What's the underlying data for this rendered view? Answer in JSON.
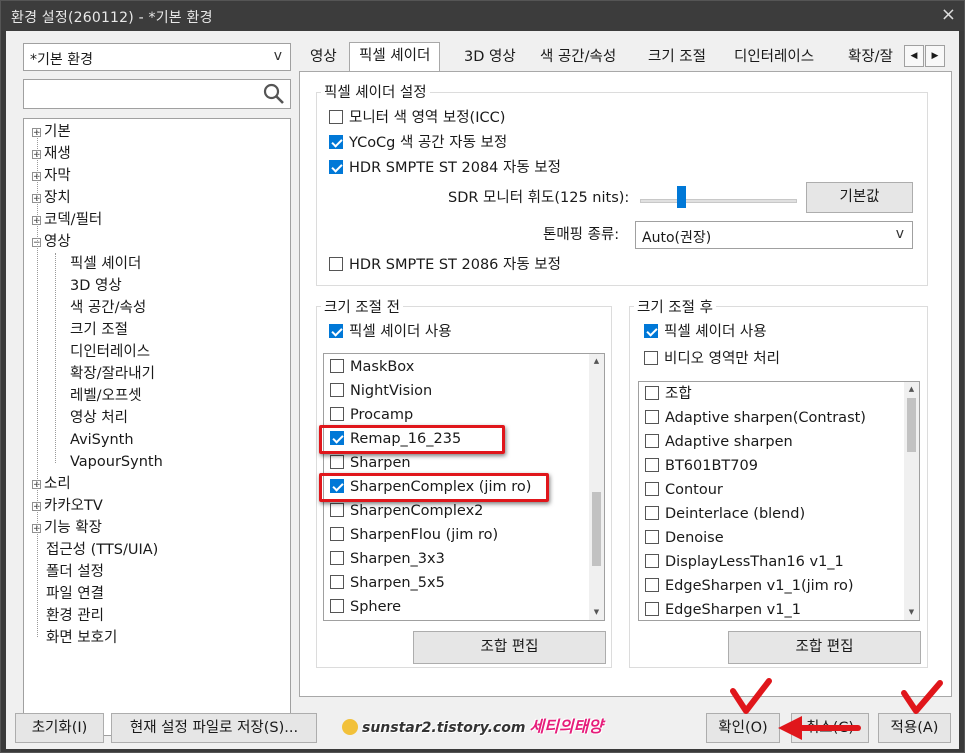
{
  "window": {
    "title": "환경 설정(260112) - *기본 환경",
    "close": "×"
  },
  "profile_combo": {
    "value": "*기본 환경",
    "arrow": "v"
  },
  "search": {
    "placeholder": ""
  },
  "tree": {
    "items": [
      {
        "label": "기본",
        "exp": "+"
      },
      {
        "label": "재생",
        "exp": "+"
      },
      {
        "label": "자막",
        "exp": "+"
      },
      {
        "label": "장치",
        "exp": "+"
      },
      {
        "label": "코덱/필터",
        "exp": "+"
      },
      {
        "label": "영상",
        "exp": "−"
      },
      {
        "label": "픽셀 셰이더"
      },
      {
        "label": "3D 영상"
      },
      {
        "label": "색 공간/속성"
      },
      {
        "label": "크기 조절"
      },
      {
        "label": "디인터레이스"
      },
      {
        "label": "확장/잘라내기"
      },
      {
        "label": "레벨/오프셋"
      },
      {
        "label": "영상 처리"
      },
      {
        "label": "AviSynth"
      },
      {
        "label": "VapourSynth"
      },
      {
        "label": "소리",
        "exp": "+"
      },
      {
        "label": "카카오TV",
        "exp": "+"
      },
      {
        "label": "기능 확장",
        "exp": "+"
      },
      {
        "label": "접근성 (TTS/UIA)"
      },
      {
        "label": "폴더 설정"
      },
      {
        "label": "파일 연결"
      },
      {
        "label": "환경 관리"
      },
      {
        "label": "화면 보호기"
      }
    ]
  },
  "tabs": [
    "영상",
    "픽셀 셰이더",
    "3D 영상",
    "색 공간/속성",
    "크기 조절",
    "디인터레이스",
    "확장/잘"
  ],
  "tab_nav": {
    "left": "◀",
    "right": "▶"
  },
  "shader_settings": {
    "title": "픽셀 셰이더 설정",
    "monitor_icc": "모니터 색 영역 보정(ICC)",
    "ycocg": "YCoCg 색 공간 자동 보정",
    "hdr2084": "HDR SMPTE ST 2084 자동 보정",
    "sdr_label": "SDR 모니터 휘도(125 nits):",
    "sdr_level_nits": 125,
    "default_button": "기본값",
    "tonemap_label": "톤매핑 종류:",
    "tonemap_value": "Auto(권장)",
    "hdr2086": "HDR SMPTE ST 2086 자동 보정"
  },
  "pre": {
    "title": "크기 조절 전",
    "use": "픽셀 셰이더 사용",
    "items": [
      {
        "label": "MaskBox",
        "checked": false
      },
      {
        "label": "NightVision",
        "checked": false
      },
      {
        "label": "Procamp",
        "checked": false
      },
      {
        "label": "Remap_16_235",
        "checked": true
      },
      {
        "label": "Sharpen",
        "checked": false
      },
      {
        "label": "SharpenComplex (jim ro)",
        "checked": true
      },
      {
        "label": "SharpenComplex2",
        "checked": false
      },
      {
        "label": "SharpenFlou (jim ro)",
        "checked": false
      },
      {
        "label": "Sharpen_3x3",
        "checked": false
      },
      {
        "label": "Sharpen_5x5",
        "checked": false
      },
      {
        "label": "Sphere",
        "checked": false
      }
    ],
    "edit": "조합 편집"
  },
  "post": {
    "title": "크기 조절 후",
    "use": "픽셀 셰이더 사용",
    "video_only": "비디오 영역만 처리",
    "items": [
      "조합",
      "Adaptive sharpen(Contrast)",
      "Adaptive sharpen",
      "BT601BT709",
      "Contour",
      "Deinterlace (blend)",
      "Denoise",
      "DisplayLessThan16 v1_1",
      "EdgeSharpen v1_1(jim ro)",
      "EdgeSharpen v1_1"
    ],
    "edit": "조합 편집"
  },
  "bottom": {
    "reset": "초기화(I)",
    "save": "현재 설정 파일로 저장(S)...",
    "ok": "확인(O)",
    "cancel": "취소(C)",
    "apply": "적용(A)"
  },
  "watermark": {
    "site": "sunstar2.tistory.com",
    "name": "세티의태양"
  },
  "colors": {
    "accent": "#0078d7",
    "highlight": "#e0161b"
  }
}
